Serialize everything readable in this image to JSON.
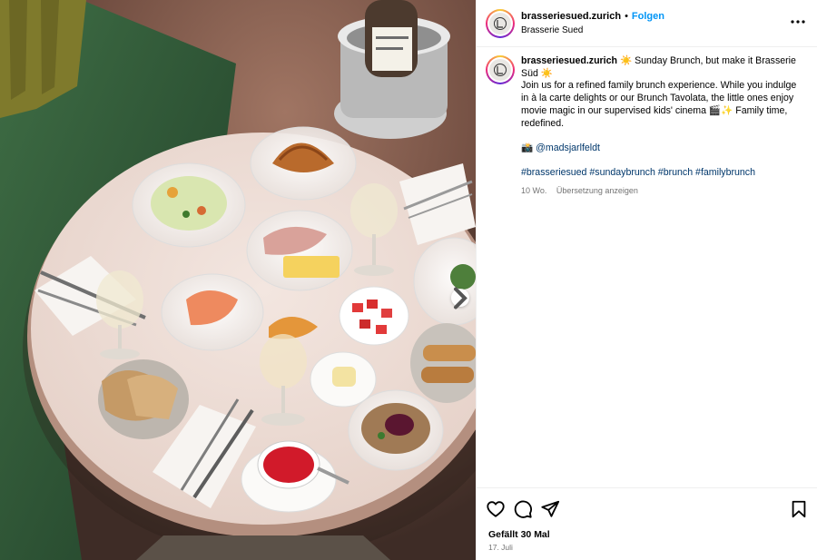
{
  "post": {
    "username": "brasseriesued.zurich",
    "separator": "•",
    "follow_label": "Folgen",
    "subtitle": "Brasserie Sued",
    "more_icon": "more-horizontal-icon"
  },
  "caption": {
    "username": "brasseriesued.zurich",
    "headline": "☀️ Sunday Brunch, but make it Brasserie Süd ☀️",
    "body": "Join us for a refined family brunch experience. While you indulge in à la carte delights or our Brunch Tavolata, the little ones enjoy movie magic in our supervised kids' cinema 🎬✨ Family time, redefined.",
    "credit_icon": "📸",
    "credit_handle": "@madsjarlfeldt",
    "hashtags": [
      "#brasseriesued",
      "#sundaybrunch",
      "#brunch",
      "#familybrunch"
    ],
    "age": "10 Wo.",
    "translate_label": "Übersetzung anzeigen"
  },
  "actions": {
    "like_icon": "heart-icon",
    "comment_icon": "comment-icon",
    "share_icon": "send-icon",
    "save_icon": "bookmark-icon",
    "likes_text": "Gefällt 30 Mal",
    "date_text": "17. Juli"
  },
  "colors": {
    "link": "#0095f6",
    "hashtag": "#00376b",
    "muted": "#737373",
    "border": "#efefef"
  }
}
